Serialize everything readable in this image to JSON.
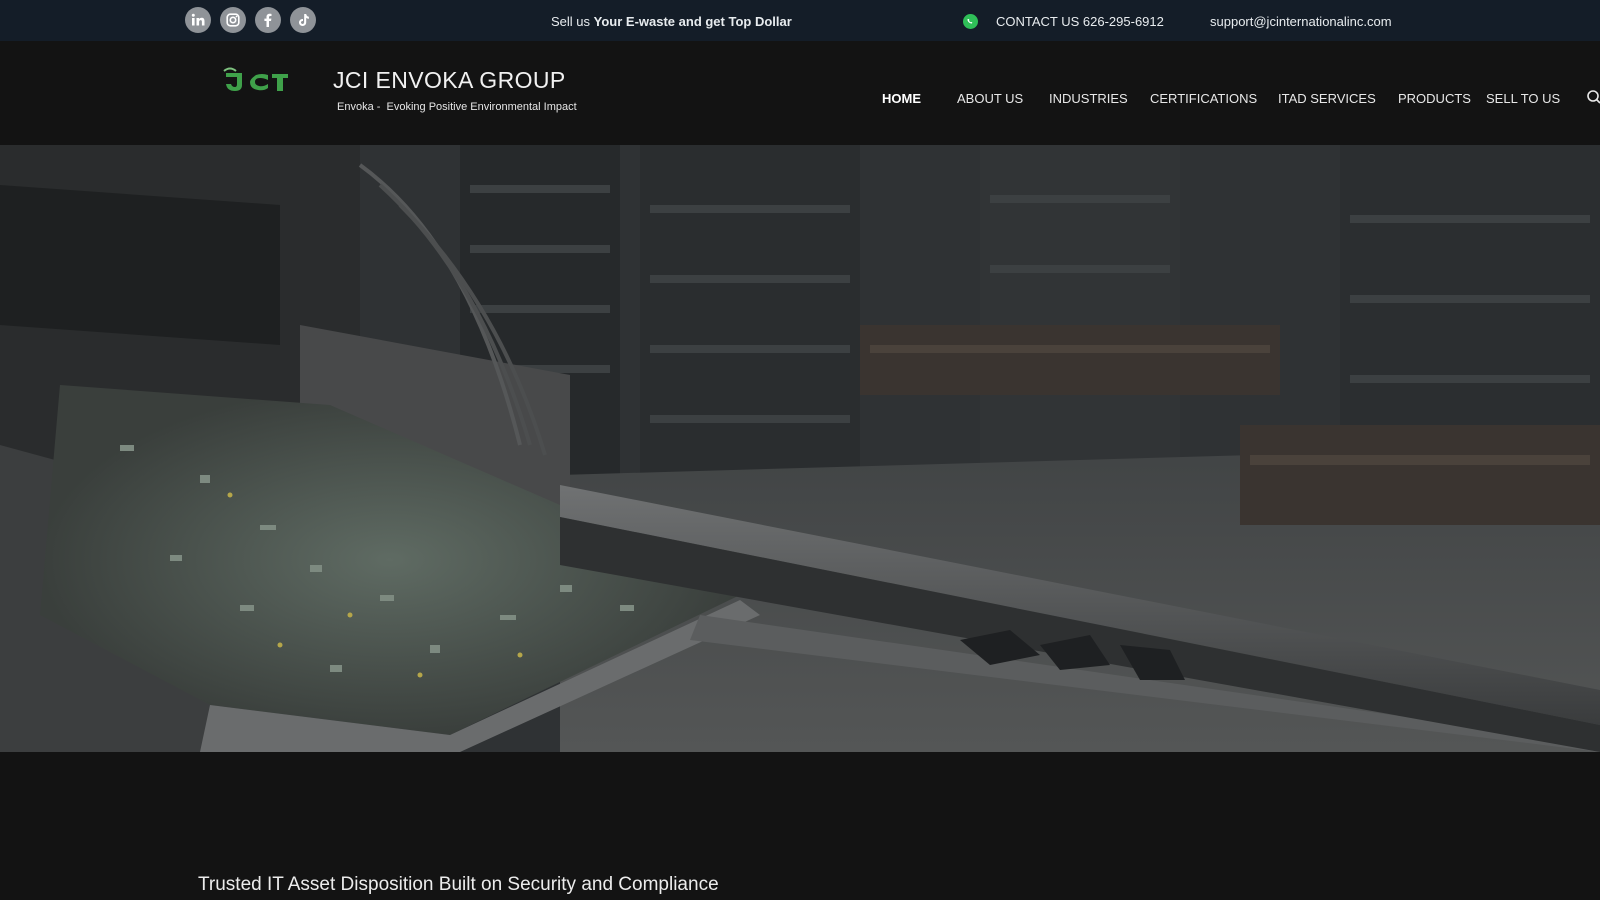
{
  "topbar": {
    "social": [
      {
        "name": "linkedin-icon",
        "glyph": "in"
      },
      {
        "name": "instagram-icon",
        "glyph": "instagram"
      },
      {
        "name": "facebook-icon",
        "glyph": "f"
      },
      {
        "name": "tiktok-icon",
        "glyph": "tiktok"
      }
    ],
    "promo_prefix": "Sell us ",
    "promo_bold": "Your E-waste and get Top Dollar",
    "contact_label": "CONTACT US 626-295-6912",
    "email": "support@jcinternationalinc.com"
  },
  "header": {
    "logo_text": "JCI",
    "title": "JCI ENVOKA GROUP",
    "tagline": "Envoka -  Evoking Positive Environmental Impact",
    "nav": [
      {
        "label": "HOME",
        "active": true
      },
      {
        "label": "ABOUT US",
        "active": false
      },
      {
        "label": "INDUSTRIES",
        "active": false
      },
      {
        "label": "CERTIFICATIONS",
        "active": false
      },
      {
        "label": "ITAD SERVICES",
        "active": false
      },
      {
        "label": "PRODUCTS",
        "active": false
      },
      {
        "label": "SELL TO US",
        "active": false
      }
    ]
  },
  "content": {
    "heading": "Trusted IT Asset Disposition Built on Security and Compliance"
  },
  "colors": {
    "topbar_bg": "#141d28",
    "page_bg": "#131313",
    "logo_green": "#3fa14a",
    "social_icon_bg": "#8f9398",
    "whatsapp_green": "#2fbf58"
  }
}
